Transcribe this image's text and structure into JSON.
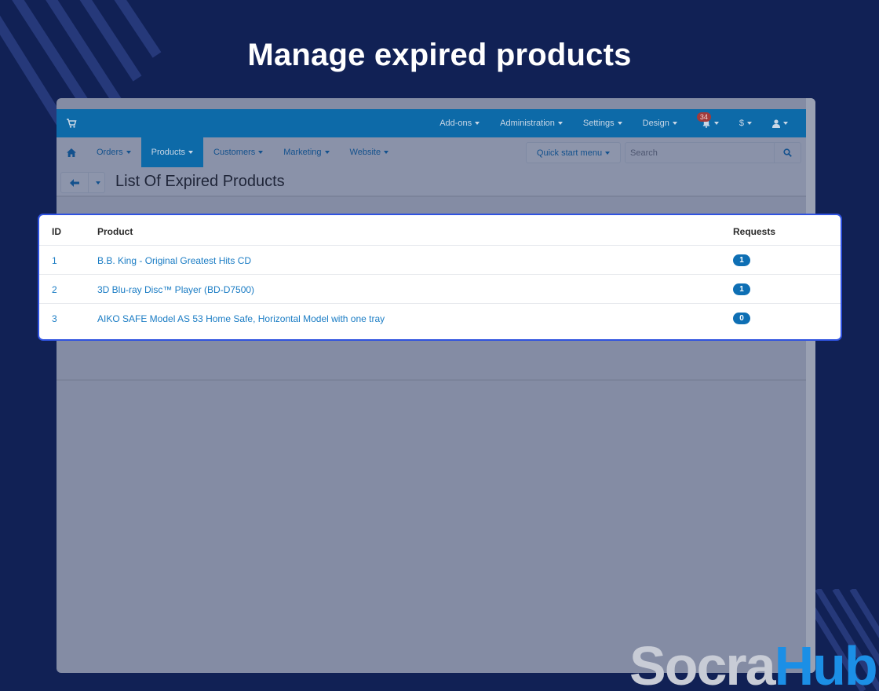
{
  "headline": "Manage expired products",
  "topbar": {
    "menu": [
      {
        "label": "Add-ons"
      },
      {
        "label": "Administration"
      },
      {
        "label": "Settings"
      },
      {
        "label": "Design"
      }
    ],
    "notifications_count": "34",
    "currency_symbol": "$"
  },
  "navbar": {
    "items": [
      {
        "label": "Orders"
      },
      {
        "label": "Products",
        "active": true
      },
      {
        "label": "Customers"
      },
      {
        "label": "Marketing"
      },
      {
        "label": "Website"
      }
    ],
    "quick_start_label": "Quick start menu",
    "search_placeholder": "Search"
  },
  "page": {
    "title": "List Of Expired Products"
  },
  "table": {
    "headers": {
      "id": "ID",
      "product": "Product",
      "requests": "Requests"
    },
    "rows": [
      {
        "id": "1",
        "product": "B.B. King - Original Greatest Hits CD",
        "requests": "1"
      },
      {
        "id": "2",
        "product": "3D Blu-ray Disc™ Player (BD-D7500)",
        "requests": "1"
      },
      {
        "id": "3",
        "product": "AIKO SAFE Model AS 53 Home Safe, Horizontal Model with one tray",
        "requests": "0"
      }
    ]
  },
  "logo": {
    "part1": "Socra",
    "part2": "Hub"
  },
  "colors": {
    "background": "#112155",
    "topbar": "#0d6aa8",
    "highlight_border": "#2f52e0",
    "link": "#1a7cc4",
    "badge": "#0e6fb4",
    "logo_accent": "#1b8fe6"
  }
}
